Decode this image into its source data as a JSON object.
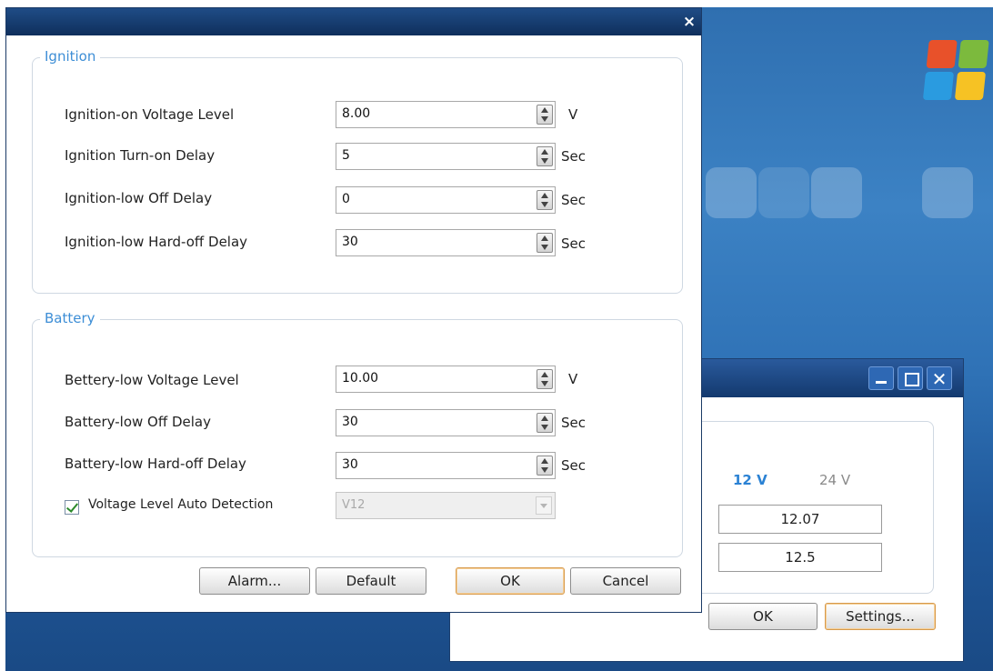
{
  "ignition": {
    "legend": "Ignition",
    "rows": [
      {
        "label": "Ignition-on Voltage Level",
        "value": "8.00",
        "unit": "V"
      },
      {
        "label": "Ignition Turn-on Delay",
        "value": "5",
        "unit": "Sec"
      },
      {
        "label": "Ignition-low Off Delay",
        "value": "0",
        "unit": "Sec"
      },
      {
        "label": "Ignition-low Hard-off Delay",
        "value": "30",
        "unit": "Sec"
      }
    ]
  },
  "battery": {
    "legend": "Battery",
    "rows": [
      {
        "label": "Bettery-low Voltage Level",
        "value": "10.00",
        "unit": "V"
      },
      {
        "label": "Battery-low Off Delay",
        "value": "30",
        "unit": "Sec"
      },
      {
        "label": "Battery-low Hard-off Delay",
        "value": "30",
        "unit": "Sec"
      }
    ],
    "auto_detect": {
      "label": "Voltage Level Auto Detection",
      "checked": true,
      "selected": "V12"
    }
  },
  "buttons": {
    "alarm": "Alarm...",
    "default": "Default",
    "ok": "OK",
    "cancel": "Cancel"
  },
  "main_dialog": {
    "close_glyph": "×"
  },
  "bg_window": {
    "close_glyph": "✕",
    "volt_12": "12 V",
    "volt_24": "24 V",
    "reading_1": "12.07",
    "reading_2": "12.5",
    "ok": "OK",
    "settings": "Settings..."
  },
  "icons": {
    "checkbox": "check-icon",
    "spin": "spin-arrows-icon",
    "dropdown": "chevron-down-icon",
    "os_logo": "windows-logo-icon"
  },
  "colors": {
    "accent_text": "#3d8ed6",
    "title_bar": "#13396e",
    "desktop": "#2f72b6",
    "default_button_border": "#d79a4c"
  }
}
